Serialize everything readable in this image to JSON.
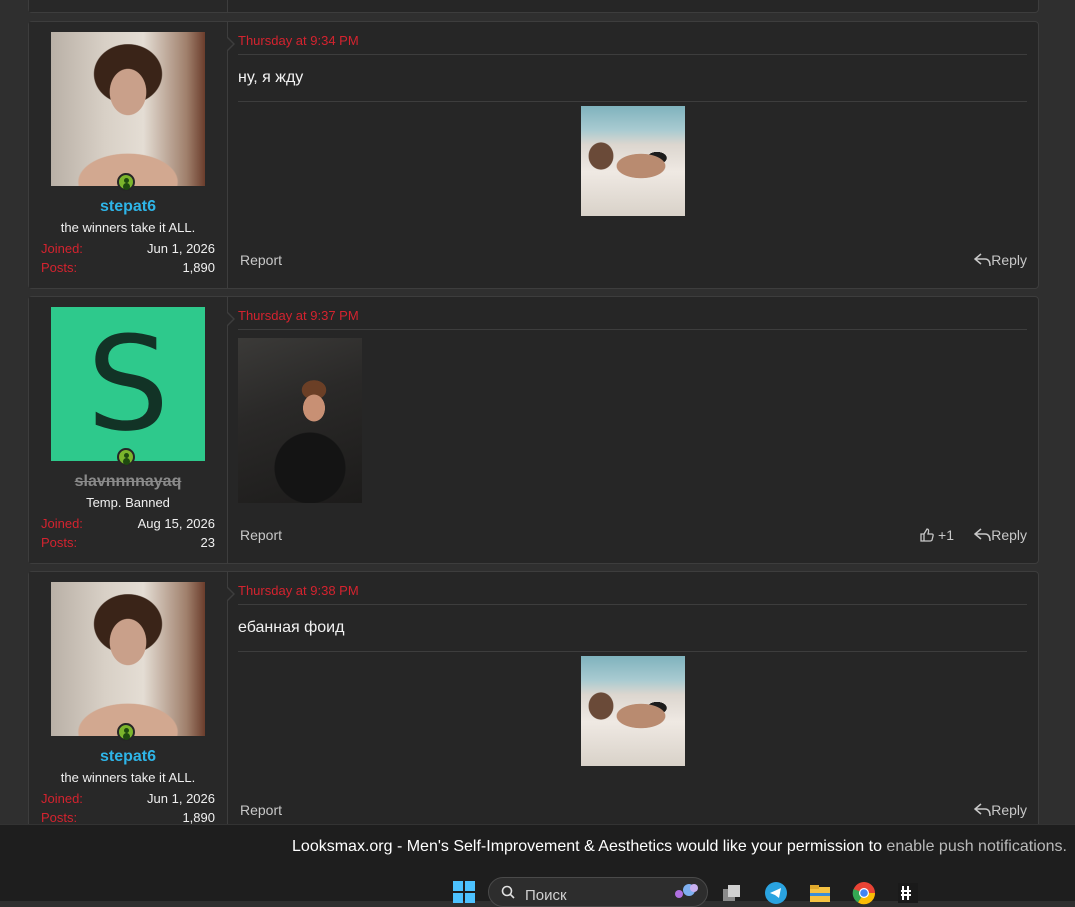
{
  "posts": [
    {
      "date": "Thursday at 9:34 PM",
      "message": "ну, я жду",
      "user": {
        "name": "stepat6",
        "title": "the winners take it ALL.",
        "joined": "Jun 1, 2026",
        "posts": "1,890"
      },
      "report": "Report",
      "reply": "Reply"
    },
    {
      "date": "Thursday at 9:37 PM",
      "user": {
        "name": "slavnnnnayaq",
        "title": "Temp. Banned",
        "joined": "Aug 15, 2026",
        "posts": "23",
        "avatar_letter": "S"
      },
      "report": "Report",
      "reactions": "+1",
      "reply": "Reply"
    },
    {
      "date": "Thursday at 9:38 PM",
      "message": "ебанная фоид",
      "user": {
        "name": "stepat6",
        "title": "the winners take it ALL.",
        "joined": "Jun 1, 2026",
        "posts": "1,890"
      },
      "report": "Report",
      "reply": "Reply"
    }
  ],
  "labels": {
    "joined": "Joined:",
    "posts": "Posts:"
  },
  "notification": {
    "text": "Looksmax.org - Men's Self-Improvement & Aesthetics would like your permission to ",
    "link": "enable push notifications."
  },
  "taskbar": {
    "search_placeholder": "Поиск"
  },
  "colors": {
    "accent_red": "#d4232f",
    "username_blue": "#2eb5e8",
    "avatar_green": "#2ec98c"
  }
}
